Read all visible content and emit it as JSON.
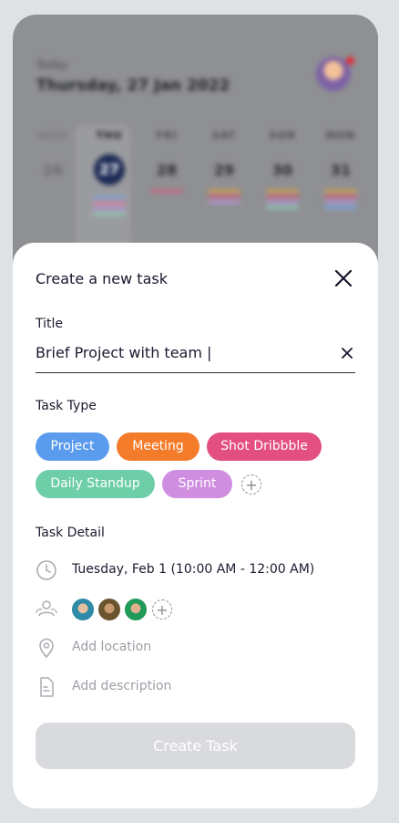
{
  "background": {
    "today_label": "Today",
    "today_date": "Thursday, 27 Jan 2022",
    "days": [
      {
        "name": "WED",
        "num": "26"
      },
      {
        "name": "THU",
        "num": "27"
      },
      {
        "name": "FRI",
        "num": "28"
      },
      {
        "name": "SAT",
        "num": "29"
      },
      {
        "name": "SUN",
        "num": "30"
      },
      {
        "name": "MON",
        "num": "31"
      }
    ]
  },
  "sheet": {
    "title": "Create a new task",
    "title_section_label": "Title",
    "title_value": "Brief Project with team |",
    "task_type_label": "Task Type",
    "task_types": [
      {
        "label": "Project",
        "color": "#5b9bed"
      },
      {
        "label": "Meeting",
        "color": "#f47b2a"
      },
      {
        "label": "Shot Dribbble",
        "color": "#e24f80"
      },
      {
        "label": "Daily Standup",
        "color": "#6dcea8"
      },
      {
        "label": "Sprint",
        "color": "#cf8ee0"
      }
    ],
    "add_type_symbol": "+",
    "task_detail_label": "Task Detail",
    "date_time": "Tuesday, Feb 1 (10:00 AM - 12:00 AM)",
    "add_member_symbol": "+",
    "location_placeholder": "Add location",
    "description_placeholder": "Add description",
    "create_button": "Create Task"
  }
}
